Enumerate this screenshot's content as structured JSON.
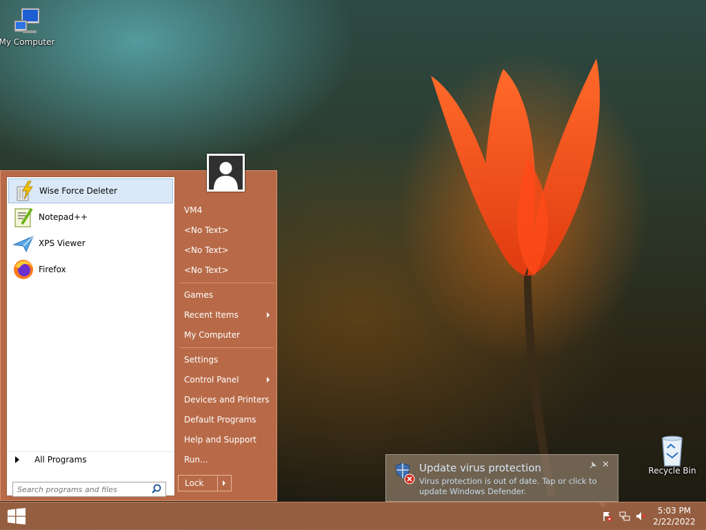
{
  "desktop": {
    "my_computer_label": "My Computer",
    "recycle_bin_label": "Recycle Bin"
  },
  "start_menu": {
    "pinned_programs": [
      {
        "label": "Wise Force Deleter",
        "icon": "wise-force-deleter-icon",
        "selected": true
      },
      {
        "label": "Notepad++",
        "icon": "notepad-plus-plus-icon"
      },
      {
        "label": "XPS Viewer",
        "icon": "xps-viewer-icon"
      },
      {
        "label": "Firefox",
        "icon": "firefox-icon"
      }
    ],
    "all_programs_label": "All Programs",
    "search_placeholder": "Search programs and files",
    "right_items": {
      "user": "VM4",
      "no_text_1": "<No Text>",
      "no_text_2": "<No Text>",
      "no_text_3": "<No Text>",
      "games": "Games",
      "recent_items": "Recent Items",
      "my_computer": "My Computer",
      "settings": "Settings",
      "control_panel": "Control Panel",
      "devices_printers": "Devices and Printers",
      "default_programs": "Default Programs",
      "help_support": "Help and Support",
      "run": "Run..."
    },
    "lock_label": "Lock"
  },
  "notification": {
    "title": "Update virus protection",
    "message": "Virus protection is out of date. Tap or click to update Windows Defender."
  },
  "taskbar": {
    "time": "5:03 PM",
    "date": "2/22/2022"
  },
  "colors": {
    "accent": "#b86a48",
    "selection": "#dbe8f7"
  }
}
